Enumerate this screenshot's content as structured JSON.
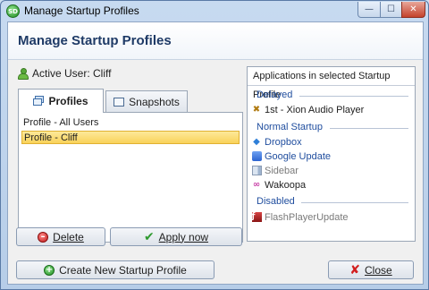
{
  "window": {
    "title": "Manage Startup Profiles",
    "app_icon_text": "SD",
    "controls": {
      "minimize": "—",
      "maximize": "☐",
      "close": "✕"
    }
  },
  "header": {
    "title": "Manage Startup Profiles"
  },
  "active_user": {
    "label": "Active User: Cliff"
  },
  "tabs": [
    {
      "label": "Profiles",
      "active": true,
      "icon": "profiles-icon"
    },
    {
      "label": "Snapshots",
      "active": false,
      "icon": "snapshots-icon"
    }
  ],
  "profiles": {
    "items": [
      {
        "label": "Profile - All Users",
        "selected": false
      },
      {
        "label": "Profile - Cliff",
        "selected": true
      }
    ]
  },
  "buttons": {
    "delete": {
      "label": "Delete",
      "icon": "delete-icon"
    },
    "apply": {
      "label": "Apply now",
      "icon": "checkmark-icon"
    },
    "create": {
      "label": "Create New Startup Profile",
      "icon": "add-icon"
    },
    "close": {
      "label": "Close",
      "icon": "close-x-icon"
    }
  },
  "apps_panel": {
    "header": "Applications in selected Startup Profile",
    "groups": [
      {
        "label": "Delayed",
        "apps": [
          {
            "name": "1st - Xion Audio Player",
            "icon": "xion-icon"
          }
        ]
      },
      {
        "label": "Normal Startup",
        "apps": [
          {
            "name": "Dropbox",
            "icon": "dropbox-icon"
          },
          {
            "name": "Google Update",
            "icon": "google-update-icon"
          },
          {
            "name": "Sidebar",
            "icon": "sidebar-icon"
          },
          {
            "name": "Wakoopa",
            "icon": "wakoopa-icon"
          }
        ]
      },
      {
        "label": "Disabled",
        "apps": [
          {
            "name": "FlashPlayerUpdate",
            "icon": "flash-icon"
          }
        ]
      }
    ]
  },
  "colors": {
    "header_title": "#1e3a66",
    "group_label": "#1f4d9e",
    "selection": "#f9d25a",
    "frame": "#b6cde8"
  }
}
